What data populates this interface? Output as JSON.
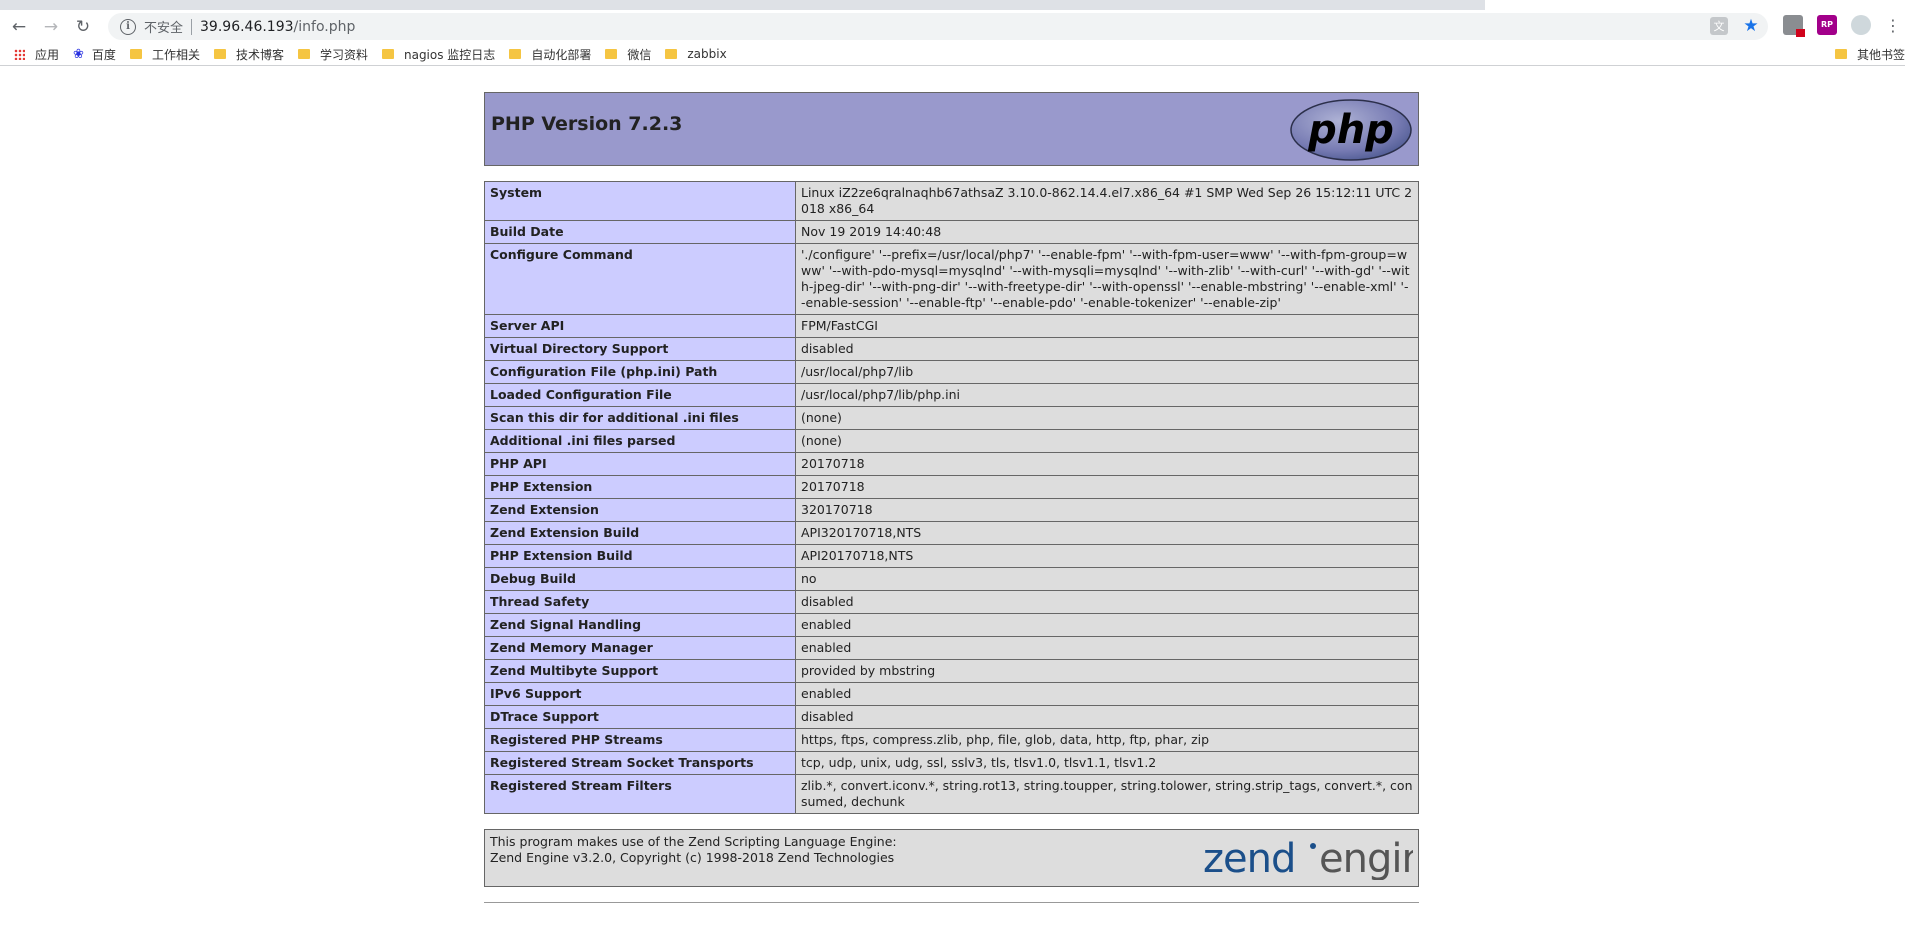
{
  "browser": {
    "security_label": "不安全",
    "url_host": "39.96.46.193",
    "url_path": "/info.php",
    "bookmarks": [
      {
        "label": "应用",
        "icon": "apps-icon"
      },
      {
        "label": "百度",
        "icon": "baidu-icon"
      },
      {
        "label": "工作相关",
        "icon": "folder-icon"
      },
      {
        "label": "技术博客",
        "icon": "folder-icon"
      },
      {
        "label": "学习资料",
        "icon": "folder-icon"
      },
      {
        "label": "nagios 监控日志",
        "icon": "folder-icon"
      },
      {
        "label": "自动化部署",
        "icon": "folder-icon"
      },
      {
        "label": "微信",
        "icon": "folder-icon"
      },
      {
        "label": "zabbix",
        "icon": "folder-icon"
      }
    ],
    "other_bookmarks": "其他书签",
    "ext2_label": "RP"
  },
  "php": {
    "title": "PHP Version 7.2.3",
    "logo_text": "php",
    "rows": [
      {
        "key": "System",
        "value": "Linux iZ2ze6qralnaqhb67athsaZ 3.10.0-862.14.4.el7.x86_64 #1 SMP Wed Sep 26 15:12:11 UTC 2018 x86_64"
      },
      {
        "key": "Build Date",
        "value": "Nov 19 2019 14:40:48"
      },
      {
        "key": "Configure Command",
        "value": "'./configure' '--prefix=/usr/local/php7' '--enable-fpm' '--with-fpm-user=www' '--with-fpm-group=www' '--with-pdo-mysql=mysqlnd' '--with-mysqli=mysqlnd' '--with-zlib' '--with-curl' '--with-gd' '--with-jpeg-dir' '--with-png-dir' '--with-freetype-dir' '--with-openssl' '--enable-mbstring' '--enable-xml' '--enable-session' '--enable-ftp' '--enable-pdo' '-enable-tokenizer' '--enable-zip'"
      },
      {
        "key": "Server API",
        "value": "FPM/FastCGI"
      },
      {
        "key": "Virtual Directory Support",
        "value": "disabled"
      },
      {
        "key": "Configuration File (php.ini) Path",
        "value": "/usr/local/php7/lib"
      },
      {
        "key": "Loaded Configuration File",
        "value": "/usr/local/php7/lib/php.ini"
      },
      {
        "key": "Scan this dir for additional .ini files",
        "value": "(none)"
      },
      {
        "key": "Additional .ini files parsed",
        "value": "(none)"
      },
      {
        "key": "PHP API",
        "value": "20170718"
      },
      {
        "key": "PHP Extension",
        "value": "20170718"
      },
      {
        "key": "Zend Extension",
        "value": "320170718"
      },
      {
        "key": "Zend Extension Build",
        "value": "API320170718,NTS"
      },
      {
        "key": "PHP Extension Build",
        "value": "API20170718,NTS"
      },
      {
        "key": "Debug Build",
        "value": "no"
      },
      {
        "key": "Thread Safety",
        "value": "disabled"
      },
      {
        "key": "Zend Signal Handling",
        "value": "enabled"
      },
      {
        "key": "Zend Memory Manager",
        "value": "enabled"
      },
      {
        "key": "Zend Multibyte Support",
        "value": "provided by mbstring"
      },
      {
        "key": "IPv6 Support",
        "value": "enabled"
      },
      {
        "key": "DTrace Support",
        "value": "disabled"
      },
      {
        "key": "Registered PHP Streams",
        "value": "https, ftps, compress.zlib, php, file, glob, data, http, ftp, phar, zip"
      },
      {
        "key": "Registered Stream Socket Transports",
        "value": "tcp, udp, unix, udg, ssl, sslv3, tls, tlsv1.0, tlsv1.1, tlsv1.2"
      },
      {
        "key": "Registered Stream Filters",
        "value": "zlib.*, convert.iconv.*, string.rot13, string.toupper, string.tolower, string.strip_tags, convert.*, consumed, dechunk"
      }
    ],
    "footer_line1": "This program makes use of the Zend Scripting Language Engine:",
    "footer_line2": "Zend Engine v3.2.0, Copyright (c) 1998-2018 Zend Technologies",
    "zend_logo_word1": "zend",
    "zend_logo_word2": "engine"
  },
  "colors": {
    "header_bg": "#9999cc",
    "key_bg": "#ccccff",
    "value_bg": "#dddddd",
    "zend_blue": "#1b4f8a"
  }
}
